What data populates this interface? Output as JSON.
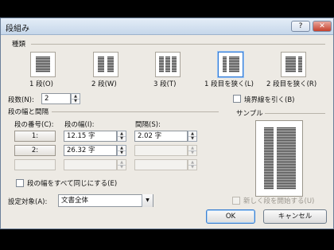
{
  "window": {
    "title": "段組み",
    "help_label": "?",
    "close_label": "✕"
  },
  "presets": {
    "section_label": "種類",
    "items": [
      {
        "label": "1 段(O)"
      },
      {
        "label": "2 段(W)"
      },
      {
        "label": "3 段(T)"
      },
      {
        "label": "1 段目を狭く(L)",
        "selected": true
      },
      {
        "label": "2 段目を狭く(R)"
      }
    ]
  },
  "column_count": {
    "label": "段数(N):",
    "value": "2"
  },
  "border_checkbox": {
    "label": "境界線を引く(B)",
    "checked": false
  },
  "width_spacing": {
    "section_label": "段の幅と間隔",
    "col_header_number": "段の番号(C):",
    "col_header_width": "段の幅(I):",
    "col_header_spacing": "間隔(S):",
    "rows": [
      {
        "number": "1:",
        "width": "12.15 字",
        "spacing": "2.02 字"
      },
      {
        "number": "2:",
        "width": "26.32 字",
        "spacing": ""
      },
      {
        "number": "",
        "width": "",
        "spacing": ""
      }
    ]
  },
  "equal_width_checkbox": {
    "label": "段の幅をすべて同じにする(E)",
    "checked": false
  },
  "preview": {
    "label": "サンプル"
  },
  "apply_to": {
    "label": "設定対象(A):",
    "value": "文書全体"
  },
  "new_column_checkbox": {
    "label": "新しく段を開始する(U)",
    "checked": false,
    "disabled": true
  },
  "buttons": {
    "ok": "OK",
    "cancel": "キャンセル"
  }
}
